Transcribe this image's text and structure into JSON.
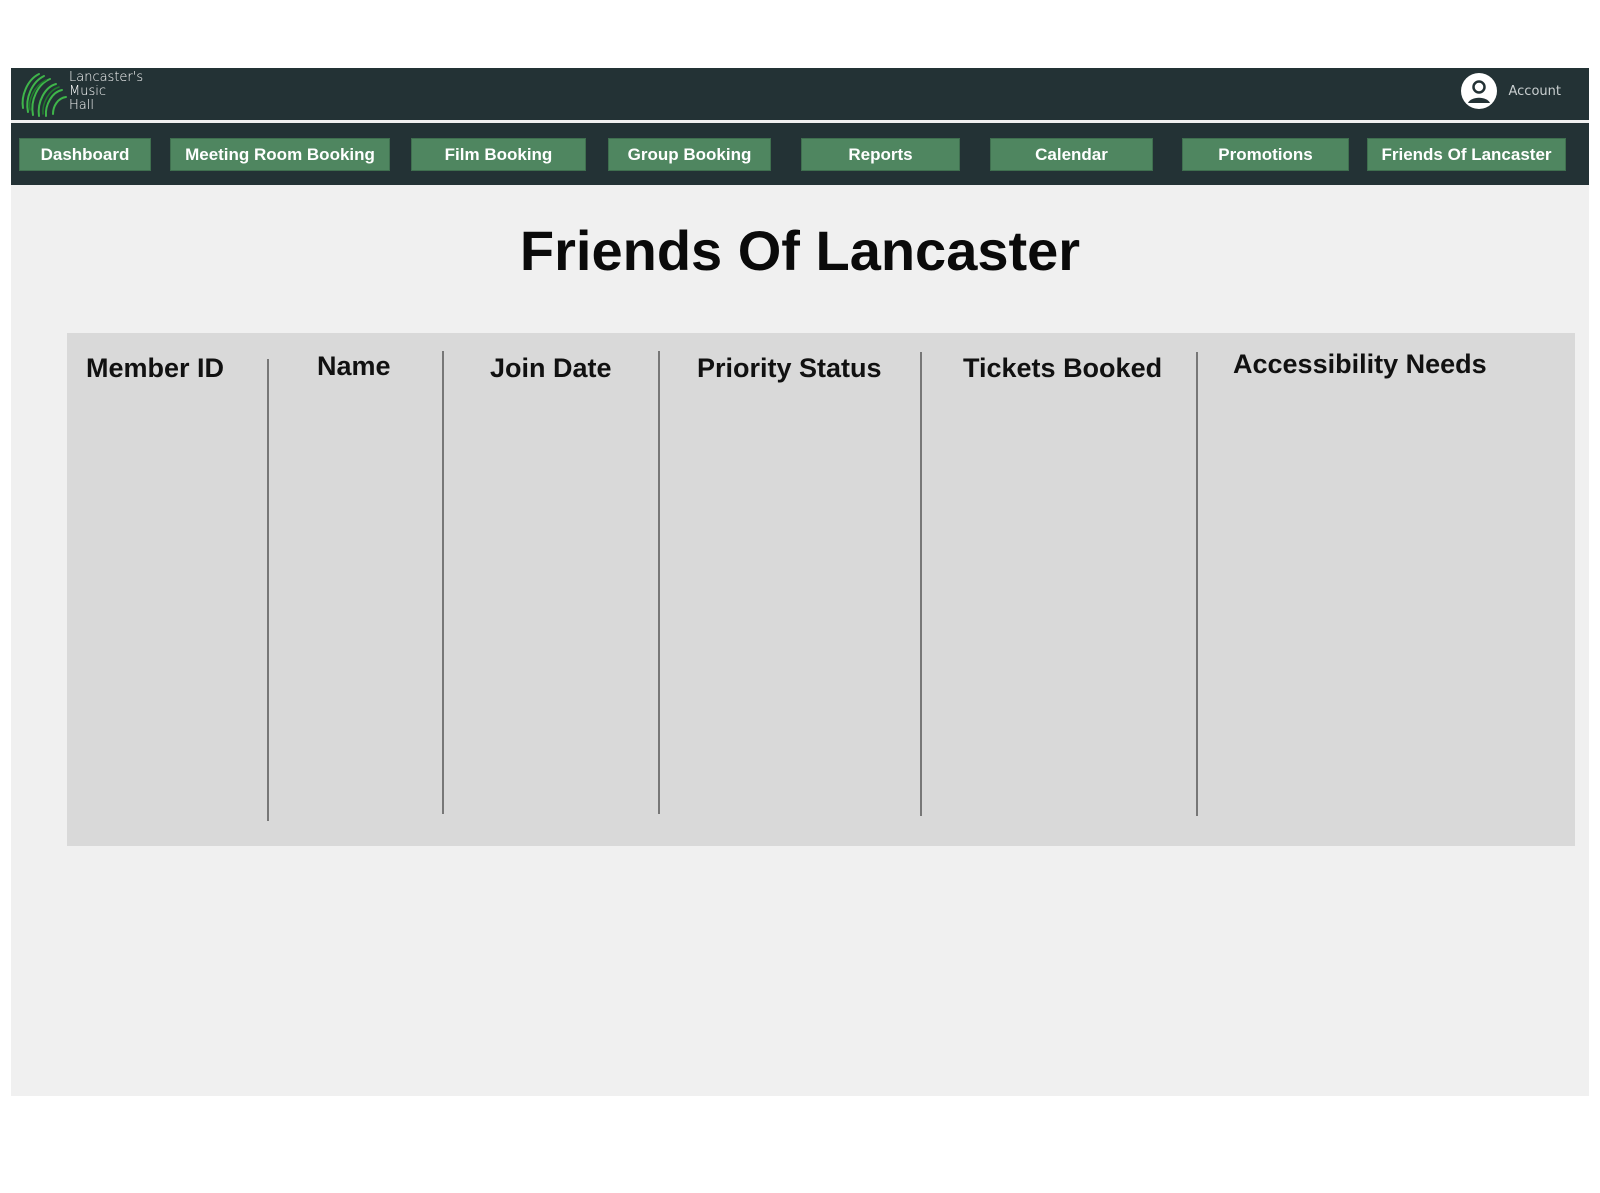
{
  "header": {
    "logo_lines": [
      "Lancaster's",
      "Music",
      "Hall"
    ],
    "account_label": "Account"
  },
  "nav": {
    "items": [
      {
        "label": "Dashboard"
      },
      {
        "label": "Meeting Room Booking"
      },
      {
        "label": "Film Booking"
      },
      {
        "label": "Group Booking"
      },
      {
        "label": "Reports"
      },
      {
        "label": "Calendar"
      },
      {
        "label": "Promotions"
      },
      {
        "label": "Friends Of Lancaster"
      }
    ]
  },
  "main": {
    "title": "Friends Of Lancaster",
    "table": {
      "columns": [
        "Member ID",
        "Name",
        "Join Date",
        "Priority Status",
        "Tickets Booked",
        "Accessibility Needs"
      ],
      "rows": []
    }
  },
  "colors": {
    "header_bg": "#233235",
    "nav_button": "#4f8660",
    "page_bg": "#f0f0f0",
    "table_bg": "#d9d9d9"
  }
}
